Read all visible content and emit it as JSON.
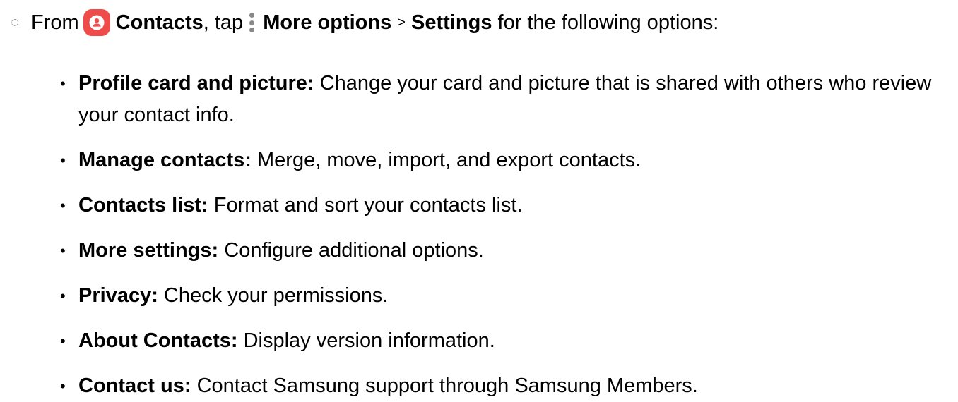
{
  "intro": {
    "text_from": "From",
    "app_name": "Contacts",
    "text_tap": ", tap",
    "menu_label": "More options",
    "separator": ">",
    "settings_label": "Settings",
    "text_tail": "for the following options:",
    "app_icon": "contacts-app-icon",
    "menu_icon": "more-options-icon",
    "app_icon_color": "#ef4b4b"
  },
  "options": [
    {
      "term": "Profile card and picture:",
      "desc": "Change your card and picture that is shared with others who review your contact info."
    },
    {
      "term": "Manage contacts:",
      "desc": "Merge, move, import, and export contacts."
    },
    {
      "term": "Contacts list:",
      "desc": "Format and sort your contacts list."
    },
    {
      "term": "More settings:",
      "desc": "Configure additional options."
    },
    {
      "term": "Privacy:",
      "desc": "Check your permissions."
    },
    {
      "term": "About Contacts:",
      "desc": "Display version information."
    },
    {
      "term": "Contact us:",
      "desc": "Contact Samsung support through Samsung Members."
    }
  ]
}
